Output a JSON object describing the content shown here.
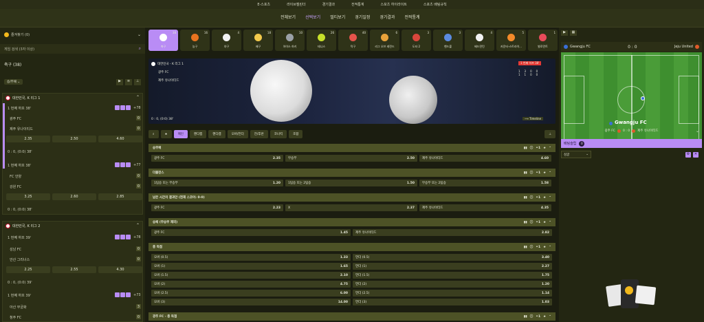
{
  "topnav": [
    "E-스포츠",
    "라이브캘린더",
    "경기결과",
    "전적통계",
    "스포츠 하이라이트",
    "스포츠 배팅규칙"
  ],
  "tabs": [
    {
      "label": "전체보기",
      "active": false
    },
    {
      "label": "선택보기",
      "active": true
    },
    {
      "label": "멀티보기",
      "active": false
    },
    {
      "label": "경기일정",
      "active": false
    },
    {
      "label": "경기결과",
      "active": false
    },
    {
      "label": "전적통계",
      "active": false
    }
  ],
  "left": {
    "favorites": "즐겨찾기 (0)",
    "search_placeholder": "게임 검색 (3자 이상)",
    "sport_title": "축구 (38)",
    "sort_label": "승/무패",
    "league1": "대한민국, K 리그 1",
    "league2": "대한민국, K 리그 2",
    "matches": [
      {
        "half": "1 번째 하프 38'",
        "more": "+78",
        "home": "광주 FC",
        "away": "제주 유나이티드",
        "hs": "0",
        "as": "0",
        "odds": [
          "2.35",
          "2.50",
          "4.60"
        ],
        "foot": "0 : 0, (0:0) 38'"
      },
      {
        "half": "1 번째 하프 38'",
        "more": "+77",
        "home": "FC 안양",
        "away": "강원 FC",
        "hs": "0",
        "as": "0",
        "odds": [
          "3.25",
          "2.60",
          "2.85"
        ],
        "foot": "0 : 0, (0:0) 38'"
      },
      {
        "half": "1 번째 하프 39'",
        "more": "+78",
        "home": "성남 FC",
        "away": "안산 그리너스",
        "hs": "0",
        "as": "0",
        "odds": [
          "2.25",
          "2.55",
          "4.30"
        ],
        "foot": "0 : 0, (0:0) 39'"
      },
      {
        "half": "1 번째 하프 39'",
        "more": "+73",
        "home": "아산 무궁화",
        "away": "청주 FC",
        "hs": "3",
        "as": "0",
        "odds": [],
        "foot": ""
      }
    ]
  },
  "sports": [
    {
      "label": "축구",
      "count": "38",
      "color": "#ffffff",
      "active": true
    },
    {
      "label": "농구",
      "count": "16",
      "color": "#e8731f",
      "active": false
    },
    {
      "label": "야구",
      "count": "4",
      "color": "#f2f2f2",
      "active": false
    },
    {
      "label": "배구",
      "count": "18",
      "color": "#f2c94c",
      "active": false
    },
    {
      "label": "아이스 하키",
      "count": "10",
      "color": "#9aa0a6",
      "active": false
    },
    {
      "label": "테니스",
      "count": "26",
      "color": "#c7e02a",
      "active": false
    },
    {
      "label": "탁구",
      "count": "40",
      "color": "#e5534b",
      "active": false
    },
    {
      "label": "리그 오브 레전드",
      "count": "6",
      "color": "#e8a23a",
      "active": false
    },
    {
      "label": "도타 2",
      "count": "3",
      "color": "#d9463c",
      "active": false
    },
    {
      "label": "핸드볼",
      "count": "3",
      "color": "#5b8ae0",
      "active": false
    },
    {
      "label": "배드민턴",
      "count": "4",
      "color": "#f2f2f2",
      "active": false
    },
    {
      "label": "카운터-스트라이...",
      "count": "5",
      "color": "#f28a2a",
      "active": false
    },
    {
      "label": "발로란트",
      "count": "1",
      "color": "#e84b5a",
      "active": false
    }
  ],
  "match": {
    "league": "대한민국 - K 리그 1",
    "home": "광주 FC",
    "away": "제주 유나이티드",
    "status": "1 번째 하프 38'",
    "score_line": "0 : 0, (0:0) 38'",
    "timeline": "Timeline",
    "stats_home": [
      "1",
      "3",
      "0",
      "0"
    ],
    "stats_away": [
      "1",
      "1",
      "0",
      "0"
    ]
  },
  "filters": [
    "★",
    "메인",
    "핸디캡",
    "핸디캡",
    "오버/언더",
    "전/후반",
    "코너킥",
    "조합"
  ],
  "markets": [
    {
      "title": "승무패",
      "count": "1",
      "rows": [
        [
          [
            "광주 FC",
            "2.35"
          ],
          [
            "무승부",
            "2.50"
          ],
          [
            "제주 유나이티드",
            "4.60"
          ]
        ]
      ]
    },
    {
      "title": "더블찬스",
      "count": "1",
      "rows": [
        [
          [
            "1팀승 또는 무승부",
            "1.20"
          ],
          [
            "1팀승 또는 2팀승",
            "1.50"
          ],
          [
            "무승부 또는 2팀승",
            "1.58"
          ]
        ]
      ]
    },
    {
      "title": "남은 시간의 결과만 (현재 스코어: 0-0)",
      "count": "1",
      "rows": [
        [
          [
            "광주 FC",
            "2.23"
          ],
          [
            "X",
            "2.37"
          ],
          [
            "제주 유나이티드",
            "4.35"
          ]
        ]
      ]
    },
    {
      "title": "승패 (무승부 제외)",
      "count": "1",
      "rows": [
        [
          [
            "광주 FC",
            "1.45"
          ],
          [
            "제주 유나이티드",
            "2.82"
          ]
        ]
      ]
    },
    {
      "title": "총 득점",
      "count": "1",
      "rows": [
        [
          [
            "오버 (0.5)",
            "1.33"
          ],
          [
            "언더 (0.5)",
            "3.40"
          ]
        ],
        [
          [
            "오버 (1)",
            "1.65"
          ],
          [
            "언더 (1)",
            "2.27"
          ]
        ],
        [
          [
            "오버 (1.5)",
            "2.10"
          ],
          [
            "언더 (1.5)",
            "1.75"
          ]
        ],
        [
          [
            "오버 (2)",
            "4.75"
          ],
          [
            "언더 (2)",
            "1.20"
          ]
        ],
        [
          [
            "오버 (2.5)",
            "6.00"
          ],
          [
            "언더 (2.5)",
            "1.14"
          ]
        ],
        [
          [
            "오버 (3)",
            "14.00"
          ],
          [
            "언더 (3)",
            "1.03"
          ]
        ]
      ]
    },
    {
      "title": "광주 FC - 총 득점",
      "count": "1",
      "rows": []
    }
  ],
  "right": {
    "home": "Gwangju FC",
    "away": "Jeju United",
    "score": "0 : 0",
    "pitch_label": "Gwangju FC",
    "mini_home": "광주 FC",
    "mini_score": "0 : 0",
    "mini_away": "제주 유나이티드",
    "betslip": "배팅슬립",
    "betslip_count": "0",
    "select_value": "싱글"
  },
  "colors": {
    "accent": "#b98cf5",
    "panel": "#2c2f16",
    "header": "#4d5226"
  }
}
